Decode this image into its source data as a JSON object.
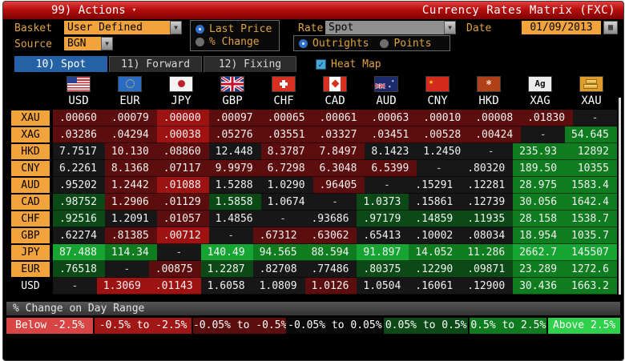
{
  "titlebar": {
    "actions_label": "99) Actions",
    "title": "Currency Rates Matrix (FXC)"
  },
  "controls": {
    "basket_label": "Basket",
    "basket_value": "User Defined",
    "source_label": "Source",
    "source_value": "BGN",
    "price_options": [
      {
        "label": "Last Price",
        "selected": true
      },
      {
        "label": "% Change",
        "selected": false
      }
    ],
    "rate_label": "Rate",
    "rate_value": "Spot",
    "outright_options": [
      {
        "label": "Outrights",
        "selected": true
      },
      {
        "label": "Points",
        "selected": false
      }
    ],
    "date_label": "Date",
    "date_value": "01/09/2013"
  },
  "tabs": [
    {
      "label": "10) Spot",
      "active": true
    },
    {
      "label": "11) Forward",
      "active": false
    },
    {
      "label": "12) Fixing",
      "active": false
    }
  ],
  "heatmap": {
    "label": "Heat Map",
    "checked": true
  },
  "icons": {
    "xag_text": "Ag"
  },
  "heat_colors": {
    "r2": "#9e1212",
    "r1": "#5c0d0d",
    "k": "#171717",
    "g1": "#0b4a16",
    "g2": "#0f7d1f",
    "g3": "#16a533"
  },
  "matrix": {
    "columns": [
      "USD",
      "EUR",
      "JPY",
      "GBP",
      "CHF",
      "CAD",
      "AUD",
      "CNY",
      "HKD",
      "XAG",
      "XAU"
    ],
    "flag_codes": [
      "us",
      "eu",
      "jp",
      "gb",
      "ch",
      "ca",
      "au",
      "cn",
      "hk",
      "ag",
      "xau"
    ],
    "rows": [
      {
        "label": "XAU",
        "plain": false,
        "values": [
          ".00060",
          ".00079",
          ".00000",
          ".00097",
          ".00065",
          ".00061",
          ".00063",
          ".00010",
          ".00008",
          ".01830",
          "-"
        ],
        "colors": [
          "r1",
          "r1",
          "r2",
          "r1",
          "r1",
          "r1",
          "r1",
          "r1",
          "r1",
          "r1",
          "k"
        ]
      },
      {
        "label": "XAG",
        "plain": false,
        "values": [
          ".03286",
          ".04294",
          ".00038",
          ".05276",
          ".03551",
          ".03327",
          ".03451",
          ".00528",
          ".00424",
          "-",
          "54.645"
        ],
        "colors": [
          "r1",
          "r1",
          "r2",
          "r1",
          "r1",
          "r1",
          "r1",
          "r1",
          "r1",
          "k",
          "g2"
        ]
      },
      {
        "label": "HKD",
        "plain": false,
        "values": [
          "7.7517",
          "10.130",
          ".08860",
          "12.448",
          "8.3787",
          "7.8497",
          "8.1423",
          "1.2450",
          "-",
          "235.93",
          "12892"
        ],
        "colors": [
          "k",
          "r1",
          "r1",
          "k",
          "r1",
          "r1",
          "k",
          "k",
          "k",
          "g2",
          "g2"
        ]
      },
      {
        "label": "CNY",
        "plain": false,
        "values": [
          "6.2261",
          "8.1368",
          ".07117",
          "9.9979",
          "6.7298",
          "6.3048",
          "6.5399",
          "-",
          ".80320",
          "189.50",
          "10355"
        ],
        "colors": [
          "k",
          "r1",
          "r1",
          "r1",
          "r1",
          "r1",
          "r1",
          "k",
          "k",
          "g2",
          "g2"
        ]
      },
      {
        "label": "AUD",
        "plain": false,
        "values": [
          ".95202",
          "1.2442",
          ".01088",
          "1.5288",
          "1.0290",
          ".96405",
          "-",
          ".15291",
          ".12281",
          "28.975",
          "1583.4"
        ],
        "colors": [
          "k",
          "r1",
          "r2",
          "k",
          "k",
          "r1",
          "k",
          "k",
          "k",
          "g2",
          "g2"
        ]
      },
      {
        "label": "CAD",
        "plain": false,
        "values": [
          ".98752",
          "1.2906",
          ".01129",
          "1.5858",
          "1.0674",
          "-",
          "1.0373",
          ".15861",
          ".12739",
          "30.056",
          "1642.4"
        ],
        "colors": [
          "g1",
          "r1",
          "r1",
          "g1",
          "k",
          "k",
          "g1",
          "k",
          "k",
          "g2",
          "g2"
        ]
      },
      {
        "label": "CHF",
        "plain": false,
        "values": [
          ".92516",
          "1.2091",
          ".01057",
          "1.4856",
          "-",
          ".93686",
          ".97179",
          ".14859",
          ".11935",
          "28.158",
          "1538.7"
        ],
        "colors": [
          "g1",
          "k",
          "r1",
          "k",
          "k",
          "k",
          "g1",
          "g1",
          "g1",
          "g2",
          "g2"
        ]
      },
      {
        "label": "GBP",
        "plain": false,
        "values": [
          ".62274",
          ".81385",
          ".00712",
          "-",
          ".67312",
          ".63062",
          ".65413",
          ".10002",
          ".08034",
          "18.954",
          "1035.7"
        ],
        "colors": [
          "k",
          "r1",
          "r2",
          "k",
          "r1",
          "r1",
          "k",
          "k",
          "k",
          "g2",
          "g2"
        ]
      },
      {
        "label": "JPY",
        "plain": false,
        "values": [
          "87.488",
          "114.34",
          "-",
          "140.49",
          "94.565",
          "88.594",
          "91.897",
          "14.052",
          "11.286",
          "2662.7",
          "145507"
        ],
        "colors": [
          "g3",
          "g2",
          "k",
          "g3",
          "g2",
          "g2",
          "g3",
          "g2",
          "g2",
          "g3",
          "g3"
        ]
      },
      {
        "label": "EUR",
        "plain": false,
        "values": [
          ".76518",
          "-",
          ".00875",
          "1.2287",
          ".82708",
          ".77486",
          ".80375",
          ".12290",
          ".09871",
          "23.289",
          "1272.6"
        ],
        "colors": [
          "g1",
          "k",
          "r1",
          "g1",
          "k",
          "k",
          "g1",
          "g1",
          "g1",
          "g2",
          "g2"
        ]
      },
      {
        "label": "USD",
        "plain": true,
        "values": [
          "-",
          "1.3069",
          ".01143",
          "1.6058",
          "1.0809",
          "1.0126",
          "1.0504",
          ".16061",
          ".12900",
          "30.436",
          "1663.2"
        ],
        "colors": [
          "k",
          "r2",
          "r2",
          "k",
          "k",
          "r1",
          "k",
          "k",
          "k",
          "g2",
          "g2"
        ]
      }
    ]
  },
  "legend": {
    "title": "% Change on Day Range",
    "ranges": [
      {
        "label": "Below -2.5%",
        "color": "#d94545",
        "flex": 105
      },
      {
        "label": "-0.5% to -2.5%",
        "color": "#a31616",
        "flex": 117
      },
      {
        "label": "-0.05% to -0.5%",
        "color": "#5c0d0d",
        "flex": 112
      },
      {
        "label": "-0.05% to 0.05%",
        "color": "#0a0a0a",
        "flex": 115
      },
      {
        "label": "0.05% to 0.5%",
        "color": "#0b4a16",
        "flex": 102
      },
      {
        "label": "0.5% to 2.5%",
        "color": "#0f7d1f",
        "flex": 93
      },
      {
        "label": "Above 2.5%",
        "color": "#2fd04a",
        "flex": 87
      }
    ]
  }
}
